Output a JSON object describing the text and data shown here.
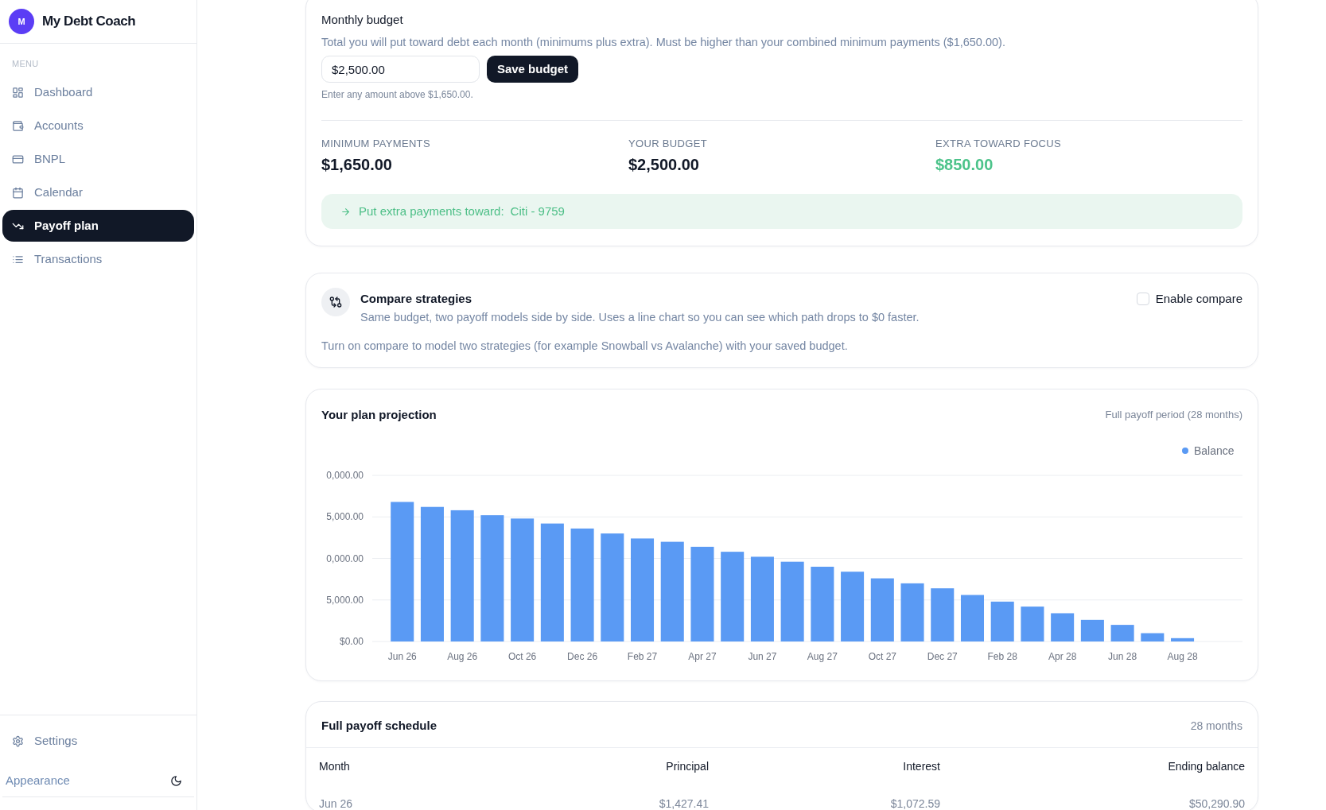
{
  "sidebar": {
    "brand": {
      "initial": "M",
      "name": "My Debt Coach"
    },
    "menu_label": "MENU",
    "items": [
      {
        "label": "Dashboard",
        "selected": false
      },
      {
        "label": "Accounts",
        "selected": false
      },
      {
        "label": "BNPL",
        "selected": false
      },
      {
        "label": "Calendar",
        "selected": false
      },
      {
        "label": "Payoff plan",
        "selected": true
      },
      {
        "label": "Transactions",
        "selected": false
      }
    ],
    "footer_items": [
      {
        "label": "Settings",
        "selected": false
      }
    ],
    "appearance": {
      "label": "Appearance"
    }
  },
  "monthly_budget": {
    "title": "Monthly budget",
    "description": "Total you will put toward debt each month (minimums plus extra). Must be higher than your combined minimum payments ($1,650.00).",
    "input_value": "$2,500.00",
    "save_button": "Save budget",
    "helper": "Enter any amount above $1,650.00.",
    "stats": [
      {
        "label": "MINIMUM PAYMENTS",
        "value": "$1,650.00",
        "highlighted": false
      },
      {
        "label": "YOUR BUDGET",
        "value": "$2,500.00",
        "highlighted": false
      },
      {
        "label": "EXTRA TOWARD FOCUS",
        "value": "$850.00",
        "highlighted": true
      }
    ],
    "focus_banner": {
      "label": "Put extra payments toward:",
      "target": "Citi - 9759"
    }
  },
  "compare": {
    "title": "Compare strategies",
    "description": "Same budget, two payoff models side by side. Uses a line chart so you can see which path drops to $0 faster.",
    "toggle": {
      "label": "Enable compare",
      "checked": false
    },
    "hint": "Turn on compare to model two strategies (for example Snowball vs Avalanche) with your saved budget."
  },
  "projection": {
    "title": "Your plan projection",
    "period": "Full payoff period (28 months)",
    "chart": {
      "legend_label": "Balance",
      "y_axis_labels": [
        "0,000.00",
        "5,000.00",
        "0,000.00",
        "5,000.00",
        "$0.00"
      ],
      "x_axis_labels": [
        "Jun 26",
        "Aug 26",
        "Oct 26",
        "Dec 26",
        "Feb 27",
        "Apr 27",
        "Jun 27",
        "Aug 27",
        "Oct 27",
        "Dec 27",
        "Feb 28",
        "Apr 28",
        "Jun 28",
        "Aug 28"
      ]
    }
  },
  "schedule": {
    "title": "Full payoff schedule",
    "count": "28 months",
    "columns": [
      "Month",
      "Principal",
      "Interest",
      "Ending balance"
    ],
    "rows": [
      [
        "Jun 26",
        "$1,427.41",
        "$1,072.59",
        "$50,290.90"
      ]
    ]
  }
}
